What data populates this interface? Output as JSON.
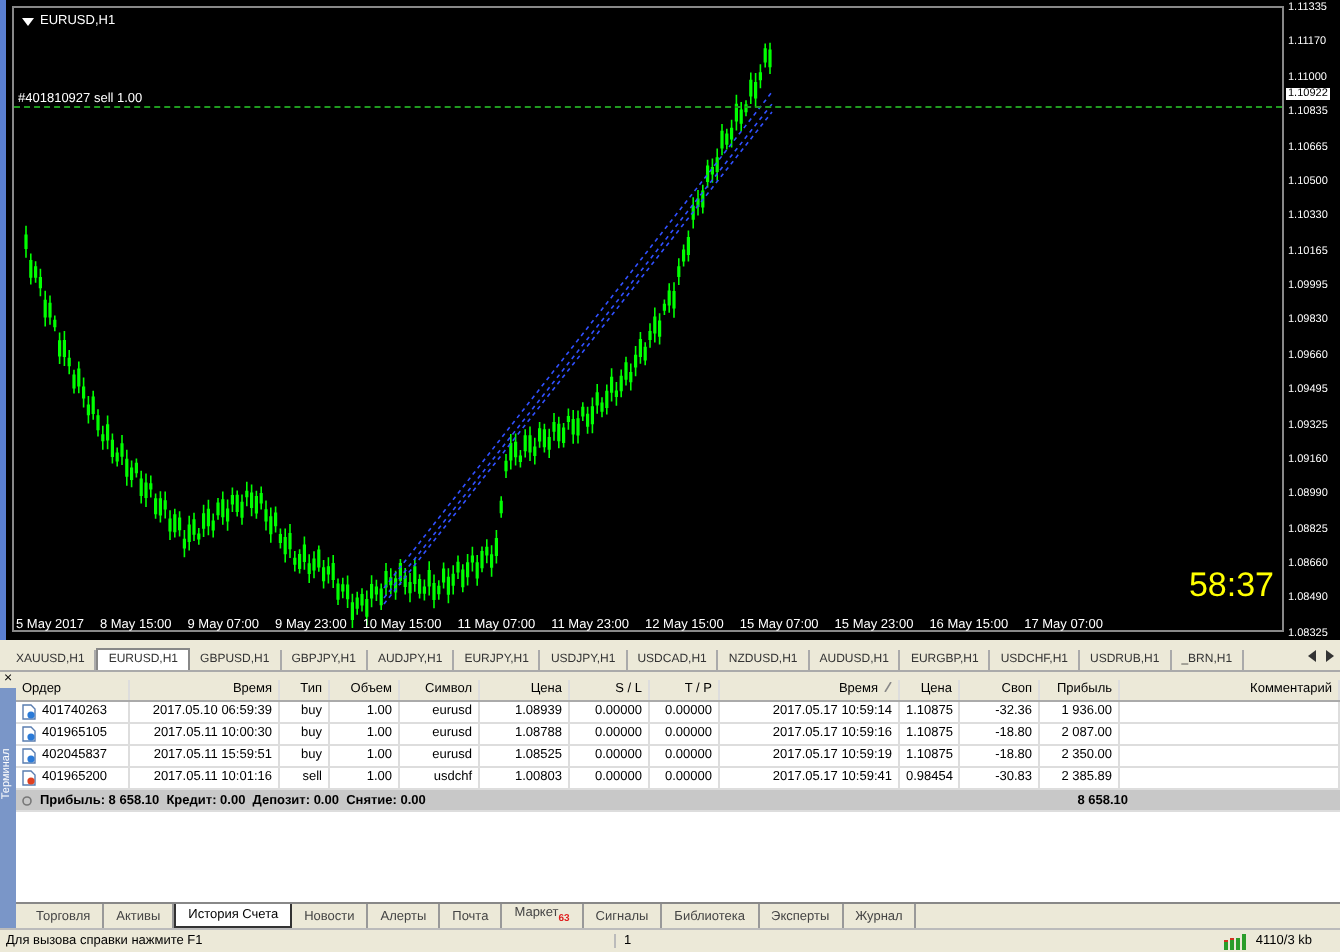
{
  "chart": {
    "title": "EURUSD,H1",
    "order_line": "#401810927 sell 1.00",
    "timer": "58:37",
    "price_labels": [
      "1.11335",
      "1.11170",
      "1.11000",
      "1.10835",
      "1.10665",
      "1.10500",
      "1.10330",
      "1.10165",
      "1.09995",
      "1.09830",
      "1.09660",
      "1.09495",
      "1.09325",
      "1.09160",
      "1.08990",
      "1.08825",
      "1.08660",
      "1.08490",
      "1.08325"
    ],
    "current_price": "1.10922",
    "time_labels": [
      "5 May 2017",
      "8 May 15:00",
      "9 May 07:00",
      "9 May 23:00",
      "10 May 15:00",
      "11 May 07:00",
      "11 May 23:00",
      "12 May 15:00",
      "15 May 07:00",
      "15 May 23:00",
      "16 May 15:00",
      "17 May 07:00"
    ]
  },
  "symbol_tabs": [
    {
      "label": "XAUUSD,H1",
      "selected": false
    },
    {
      "label": "EURUSD,H1",
      "selected": true
    },
    {
      "label": "GBPUSD,H1",
      "selected": false
    },
    {
      "label": "GBPJPY,H1",
      "selected": false
    },
    {
      "label": "AUDJPY,H1",
      "selected": false
    },
    {
      "label": "EURJPY,H1",
      "selected": false
    },
    {
      "label": "USDJPY,H1",
      "selected": false
    },
    {
      "label": "USDCAD,H1",
      "selected": false
    },
    {
      "label": "NZDUSD,H1",
      "selected": false
    },
    {
      "label": "AUDUSD,H1",
      "selected": false
    },
    {
      "label": "EURGBP,H1",
      "selected": false
    },
    {
      "label": "USDCHF,H1",
      "selected": false
    },
    {
      "label": "USDRUB,H1",
      "selected": false
    },
    {
      "label": "_BRN,H1",
      "selected": false
    }
  ],
  "terminal": {
    "close": "×",
    "title": "Терминал",
    "table": {
      "columns": [
        "Ордер",
        "Время",
        "Тип",
        "Объем",
        "Символ",
        "Цена",
        "S / L",
        "T / P",
        "Время",
        "Цена",
        "Своп",
        "Прибыль",
        "Комментарий"
      ],
      "rows": [
        {
          "kind": "buy",
          "cells": [
            "401740263",
            "2017.05.10 06:59:39",
            "buy",
            "1.00",
            "eurusd",
            "1.08939",
            "0.00000",
            "0.00000",
            "2017.05.17 10:59:14",
            "1.10875",
            "-32.36",
            "1 936.00",
            ""
          ]
        },
        {
          "kind": "buy",
          "cells": [
            "401965105",
            "2017.05.11 10:00:30",
            "buy",
            "1.00",
            "eurusd",
            "1.08788",
            "0.00000",
            "0.00000",
            "2017.05.17 10:59:16",
            "1.10875",
            "-18.80",
            "2 087.00",
            ""
          ]
        },
        {
          "kind": "buy",
          "cells": [
            "402045837",
            "2017.05.11 15:59:51",
            "buy",
            "1.00",
            "eurusd",
            "1.08525",
            "0.00000",
            "0.00000",
            "2017.05.17 10:59:19",
            "1.10875",
            "-18.80",
            "2 350.00",
            ""
          ]
        },
        {
          "kind": "sell",
          "cells": [
            "401965200",
            "2017.05.11 10:01:16",
            "sell",
            "1.00",
            "usdchf",
            "1.00803",
            "0.00000",
            "0.00000",
            "2017.05.17 10:59:41",
            "0.98454",
            "-30.83",
            "2 385.89",
            ""
          ]
        }
      ],
      "summary": "Прибыль: 8 658.10  Кредит: 0.00  Депозит: 0.00  Снятие: 0.00",
      "summary_total": "8 658.10"
    },
    "tabs": [
      {
        "label": "Торговля",
        "selected": false
      },
      {
        "label": "Активы",
        "selected": false
      },
      {
        "label": "История Счета",
        "selected": true
      },
      {
        "label": "Новости",
        "selected": false
      },
      {
        "label": "Алерты",
        "selected": false
      },
      {
        "label": "Почта",
        "selected": false
      },
      {
        "label": "Маркет",
        "selected": false,
        "badge": "63"
      },
      {
        "label": "Сигналы",
        "selected": false
      },
      {
        "label": "Библиотека",
        "selected": false
      },
      {
        "label": "Эксперты",
        "selected": false
      },
      {
        "label": "Журнал",
        "selected": false
      }
    ]
  },
  "status_bar": {
    "help": "Для вызова справки нажмите F1",
    "field_2": "1",
    "traffic": "4110/3 kb"
  }
}
